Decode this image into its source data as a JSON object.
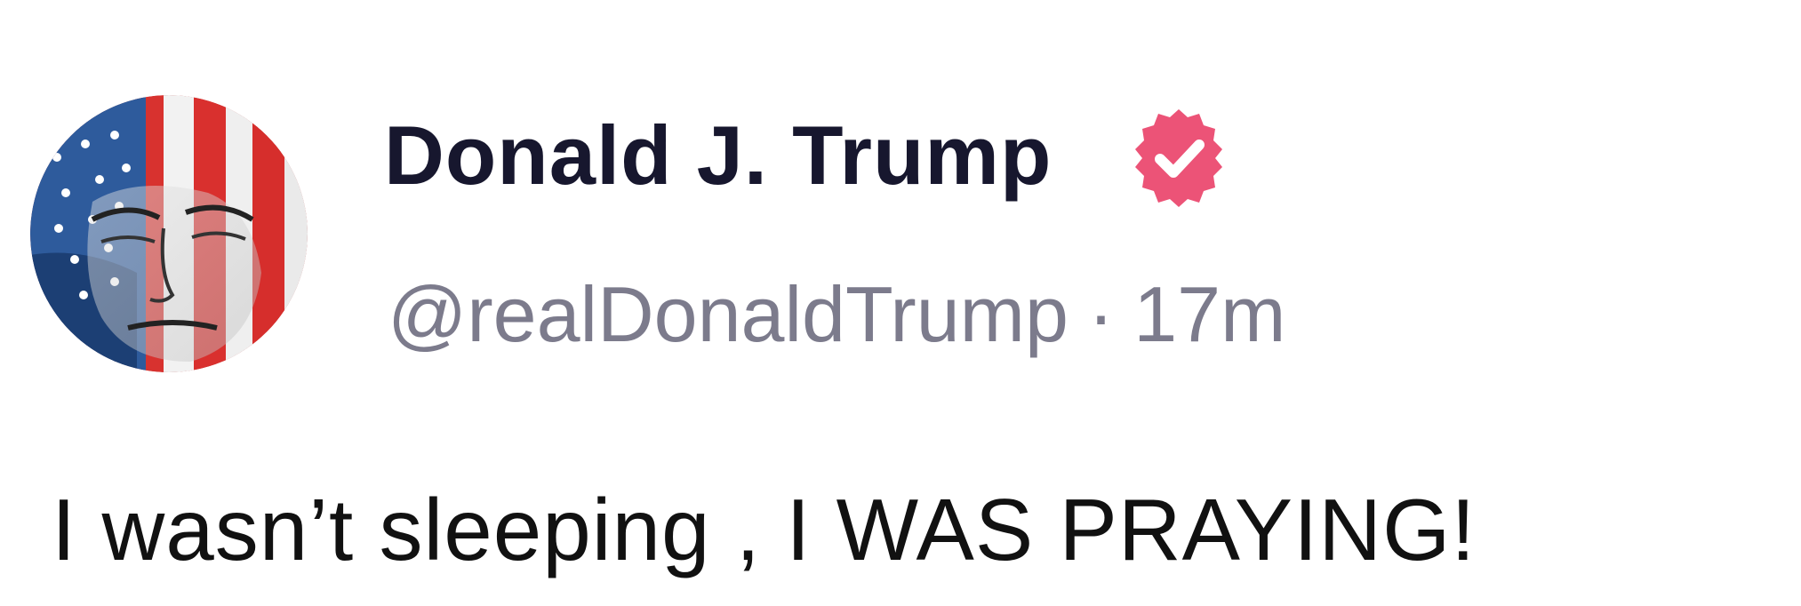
{
  "post": {
    "author": {
      "display_name": "Donald J. Trump",
      "handle": "@realDonaldTrump",
      "verified": true,
      "verified_icon": "verified-badge-icon",
      "verified_color": "#ec5377"
    },
    "meta_separator": "·",
    "timestamp": "17m",
    "text": "I wasn’t sleeping , I WAS PRAYING!"
  },
  "colors": {
    "name": "#17172e",
    "meta": "#7c7b8c",
    "text": "#111111",
    "background": "#ffffff"
  }
}
